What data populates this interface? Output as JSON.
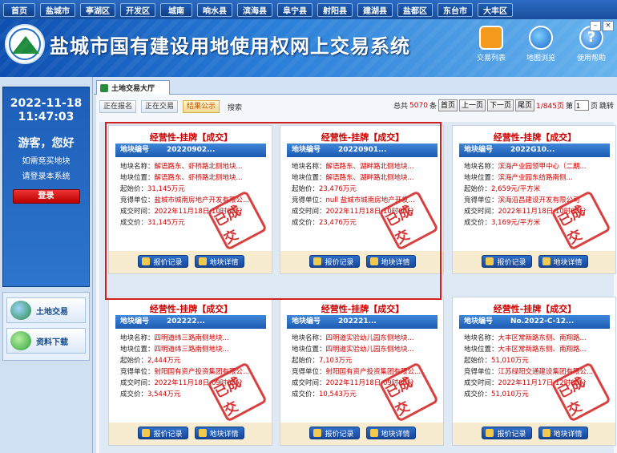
{
  "topnav": [
    "首页",
    "盐城市",
    "亭湖区",
    "开发区",
    "城南",
    "响水县",
    "滨海县",
    "阜宁县",
    "射阳县",
    "建湖县",
    "盐都区",
    "东台市",
    "大丰区"
  ],
  "header": {
    "title": "盐城市国有建设用地使用权网上交易系统",
    "icons": [
      {
        "name": "house-icon",
        "label": "交易列表"
      },
      {
        "name": "globe-icon",
        "label": "地图浏览"
      },
      {
        "name": "help-icon",
        "label": "使用帮助",
        "glyph": "?"
      }
    ],
    "window_controls": {
      "minimize": "–",
      "close": "×"
    }
  },
  "sidebar": {
    "date": "2022-11-18",
    "time": "11:47:03",
    "greeting": "游客，您好",
    "link1": "如需竞买地块",
    "link2": "请登录本系统",
    "login": "登录",
    "items": [
      "土地交易",
      "资料下载"
    ]
  },
  "tab": {
    "label": "土地交易大厅"
  },
  "filters": {
    "buttons": [
      "正在报名",
      "正在交易",
      "结果公示"
    ],
    "active_index": 2,
    "search": "搜索"
  },
  "pager": {
    "total_prefix": "总共",
    "total": "5070",
    "total_suffix": "条",
    "first": "首页",
    "prev": "上一页",
    "next": "下一页",
    "last": "尾页",
    "page_info": "1/845页",
    "page_label": "第",
    "page_value": "1",
    "page_suffix": "页",
    "jump": "跳转"
  },
  "stamp_text": "已成交",
  "buttons": {
    "bid_record": "报价记录",
    "detail": "地块详情"
  },
  "cards": [
    {
      "title": "经营性-挂牌【成交】",
      "head_label": "地块编号",
      "head_value": "20220902...",
      "rows": [
        {
          "k": "地块名称：",
          "v": "解语路东、虾桥路北侧地块..."
        },
        {
          "k": "地块位置：",
          "v": "解语路东、虾桥路北侧地块..."
        },
        {
          "k": "起始价：",
          "v": "31,145万元"
        },
        {
          "k": "竞得单位：",
          "v": "盐城市城南房地产开发有限公..."
        },
        {
          "k": "成交时间：",
          "v": "2022年11月18日 10时00分"
        },
        {
          "k": "成交价：",
          "v": "31,145万元"
        }
      ]
    },
    {
      "title": "经营性-挂牌【成交】",
      "head_label": "地块编号",
      "head_value": "20220901...",
      "rows": [
        {
          "k": "地块名称：",
          "v": "解语路东、湖畔路北侧地块..."
        },
        {
          "k": "地块位置：",
          "v": "解语路东、湖畔路北侧地块..."
        },
        {
          "k": "起始价：",
          "v": "23,476万元"
        },
        {
          "k": "竞得单位：",
          "v": "null 盐城市城南房地产开发..."
        },
        {
          "k": "成交时间：",
          "v": "2022年11月18日 10时00分"
        },
        {
          "k": "成交价：",
          "v": "23,476万元"
        }
      ]
    },
    {
      "title": "经营性-挂牌【成交】",
      "head_label": "地块编号",
      "head_value": "2022G10...",
      "rows": [
        {
          "k": "地块名称：",
          "v": "滨海产业园领甲中心（二期..."
        },
        {
          "k": "地块位置：",
          "v": "滨海产业园东纺路南侧..."
        },
        {
          "k": "起始价：",
          "v": "2,659元/平方米"
        },
        {
          "k": "竞得单位：",
          "v": "滨海沿昌建设开发有限公司"
        },
        {
          "k": "成交时间：",
          "v": "2022年11月18日 10时00分"
        },
        {
          "k": "成交价：",
          "v": "3,169元/平方米"
        }
      ]
    },
    {
      "title": "经营性-挂牌【成交】",
      "head_label": "地块编号",
      "head_value": "202222...",
      "rows": [
        {
          "k": "地块名称：",
          "v": "四明道纬三路南侧地块..."
        },
        {
          "k": "地块位置：",
          "v": "四明道纬三路南侧地块..."
        },
        {
          "k": "起始价：",
          "v": "2,444万元"
        },
        {
          "k": "竞得单位：",
          "v": "射阳国有资产投资集团有限公..."
        },
        {
          "k": "成交时间：",
          "v": "2022年11月18日 09时00分"
        },
        {
          "k": "成交价：",
          "v": "3,544万元"
        }
      ]
    },
    {
      "title": "经营性-挂牌【成交】",
      "head_label": "地块编号",
      "head_value": "202221...",
      "rows": [
        {
          "k": "地块名称：",
          "v": "四明道实验幼儿园东侧地块..."
        },
        {
          "k": "地块位置：",
          "v": "四明道实验幼儿园东侧地块..."
        },
        {
          "k": "起始价：",
          "v": "7,103万元"
        },
        {
          "k": "竞得单位：",
          "v": "射阳国有资产投资集团有限公..."
        },
        {
          "k": "成交时间：",
          "v": "2022年11月18日 09时00分"
        },
        {
          "k": "成交价：",
          "v": "10,543万元"
        }
      ]
    },
    {
      "title": "经营性-挂牌【成交】",
      "head_label": "地块编号",
      "head_value": "No.2022-C-12...",
      "rows": [
        {
          "k": "地块名称：",
          "v": "大丰区常新路东侧、南翔路..."
        },
        {
          "k": "地块位置：",
          "v": "大丰区常新路东侧、南翔路..."
        },
        {
          "k": "起始价：",
          "v": "51,010万元"
        },
        {
          "k": "竞得单位：",
          "v": "江苏绿阳交通建设集团有限公..."
        },
        {
          "k": "成交时间：",
          "v": "2022年11月17日 12时00分"
        },
        {
          "k": "成交价：",
          "v": "51,010万元"
        }
      ]
    }
  ]
}
